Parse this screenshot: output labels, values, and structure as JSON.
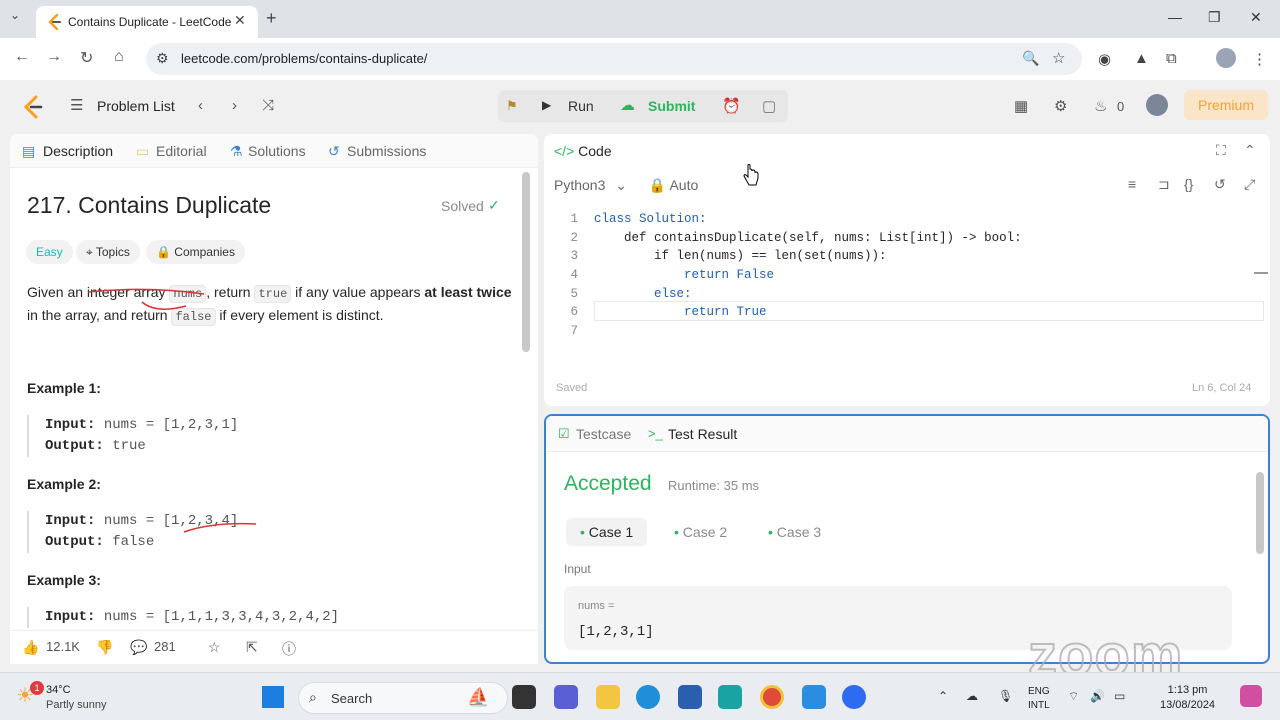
{
  "browser": {
    "tab_title": "Contains Duplicate - LeetCode",
    "new_tab": "+",
    "url": "leetcode.com/problems/contains-duplicate/"
  },
  "header": {
    "problem_list": "Problem List",
    "run": "Run",
    "submit": "Submit",
    "streak": "0",
    "premium": "Premium"
  },
  "left": {
    "tabs": [
      "Description",
      "Editorial",
      "Solutions",
      "Submissions"
    ],
    "title": "217. Contains Duplicate",
    "solved": "Solved",
    "chips": [
      "Easy",
      "Topics",
      "Companies"
    ],
    "desc": {
      "p1": "Given an integer array ",
      "c1": "nums",
      "p2": ", return ",
      "c2": "true",
      "p3": " if any value appears ",
      "b1": "at least twice",
      "p4": " in the array, and return ",
      "c3": "false",
      "p5": " if every element is distinct."
    },
    "examples": [
      {
        "heading": "Example 1:",
        "input_label": "Input:",
        "input": "nums = [1,2,3,1]",
        "output_label": "Output:",
        "output": "true"
      },
      {
        "heading": "Example 2:",
        "input_label": "Input:",
        "input": "nums = [1,2,3,4]",
        "output_label": "Output:",
        "output": "false"
      },
      {
        "heading": "Example 3:",
        "input_label": "Input:",
        "input": "nums = [1,1,1,3,3,4,3,2,4,2]"
      }
    ],
    "likes": "12.1K",
    "comments": "281"
  },
  "editor": {
    "header": "Code",
    "language": "Python3",
    "mode": "Auto",
    "lines": [
      {
        "n": "1",
        "code": "class Solution:"
      },
      {
        "n": "2",
        "code": "    def containsDuplicate(self, nums: List[int]) -> bool:"
      },
      {
        "n": "3",
        "code": "        if len(nums) == len(set(nums)):"
      },
      {
        "n": "4",
        "code": "            return False"
      },
      {
        "n": "5",
        "code": "        else:"
      },
      {
        "n": "6",
        "code": "            return True"
      },
      {
        "n": "7",
        "code": ""
      }
    ],
    "status": "Saved",
    "position": "Ln 6, Col 24"
  },
  "tests": {
    "tab_testcase": "Testcase",
    "tab_result": "Test Result",
    "verdict": "Accepted",
    "runtime": "Runtime: 35 ms",
    "cases": [
      "Case 1",
      "Case 2",
      "Case 3"
    ],
    "input_label": "Input",
    "var_name": "nums =",
    "var_value": "[1,2,3,1]"
  },
  "watermark": "zoom",
  "taskbar": {
    "temp": "34°C",
    "weather": "Partly sunny",
    "notif_count": "1",
    "search": "Search",
    "lang1": "ENG",
    "lang2": "INTL",
    "time": "1:13 pm",
    "date": "13/08/2024"
  },
  "colors": {
    "accent_green": "#2db55d",
    "premium": "#f0a23a",
    "focus_blue": "#3b82d6"
  }
}
